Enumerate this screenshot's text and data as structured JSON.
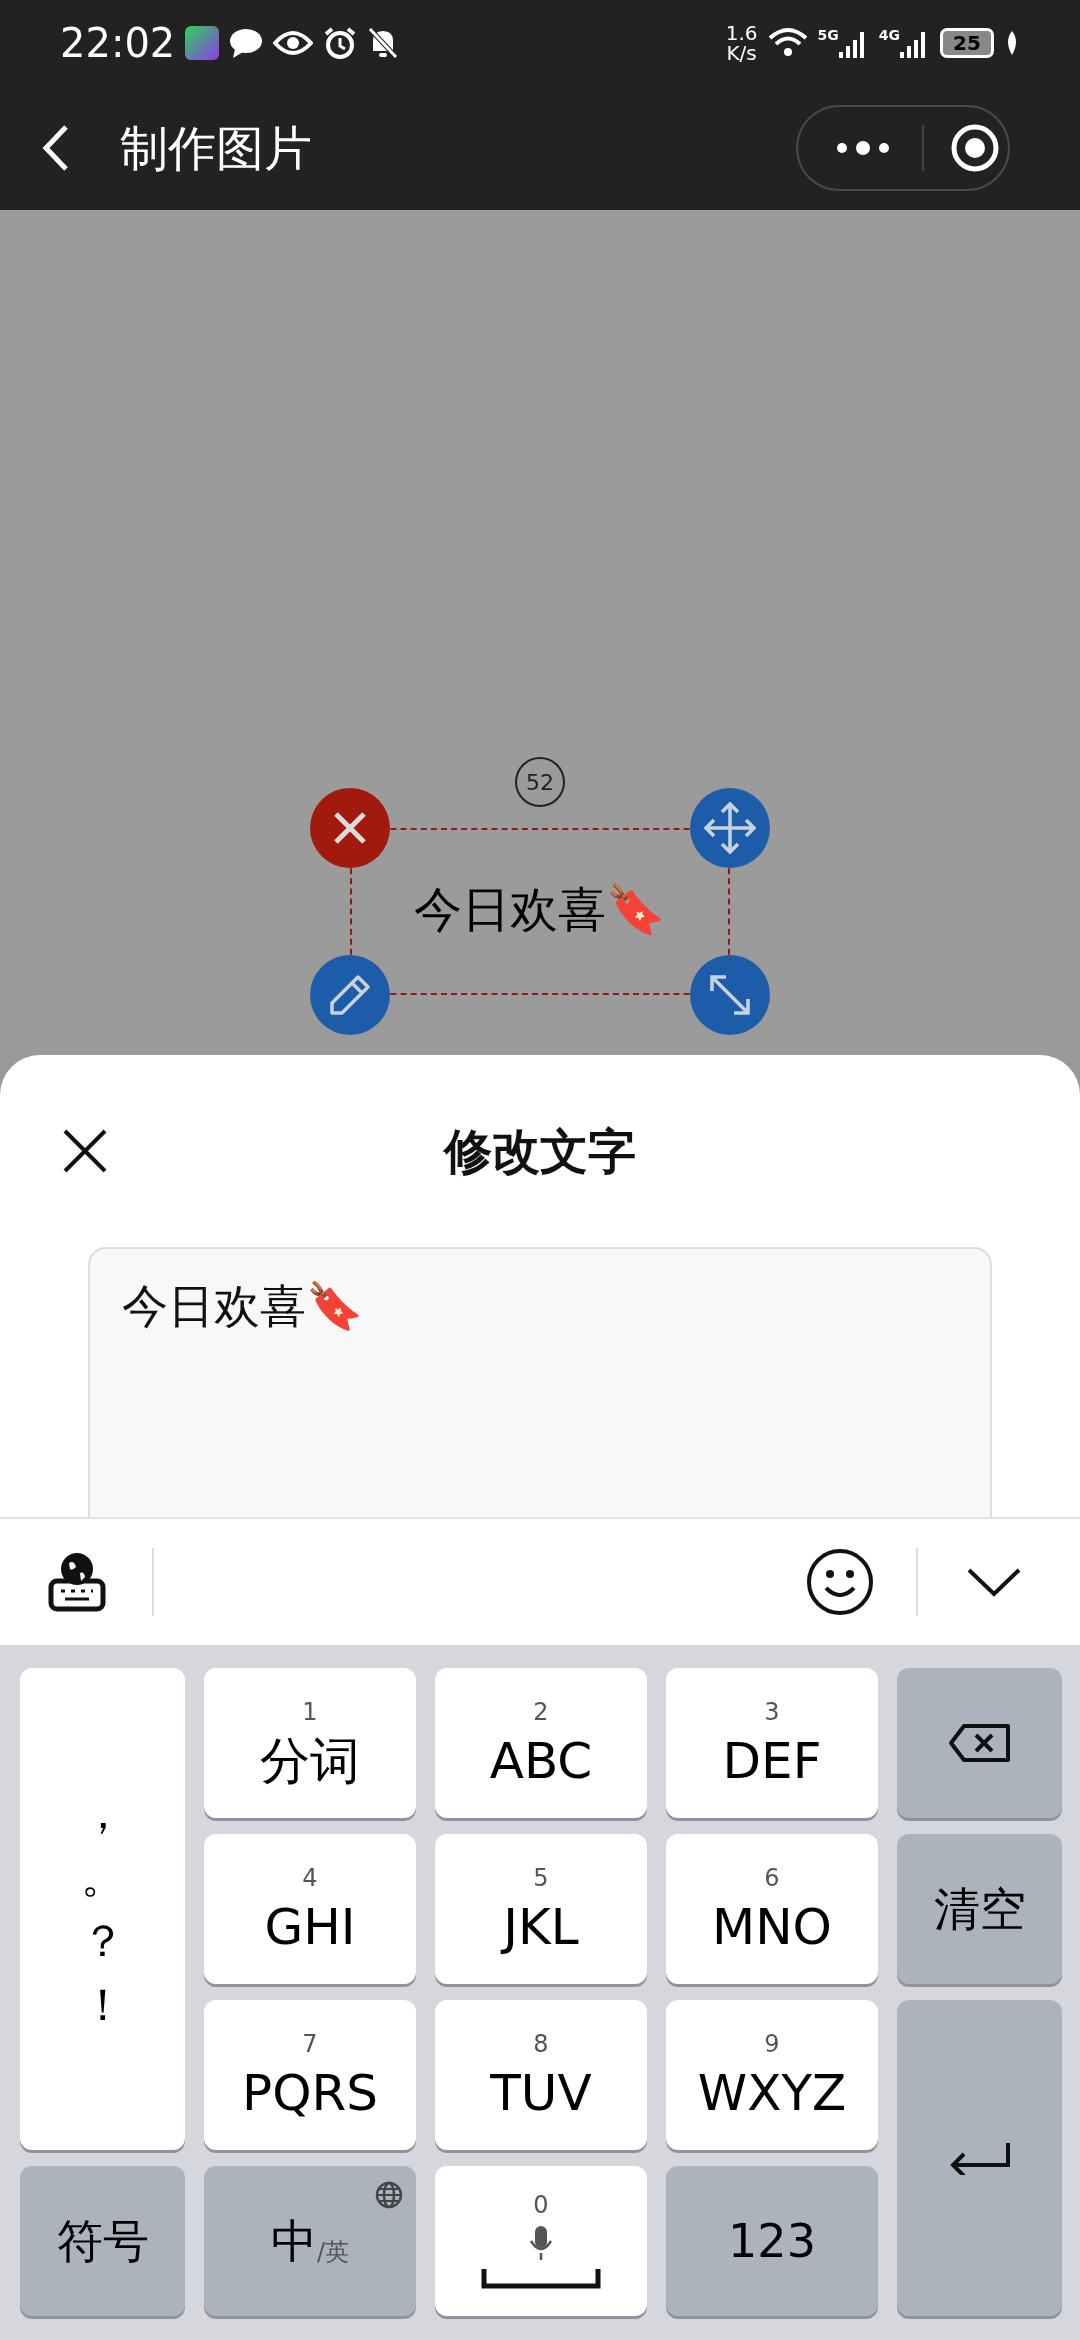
{
  "status_bar": {
    "time": "22:02",
    "net_speed": "1.6",
    "net_unit": "K/s",
    "signals": [
      "5G",
      "4G"
    ],
    "battery": "25"
  },
  "nav_bar": {
    "title": "制作图片"
  },
  "canvas": {
    "layer_number": "52",
    "text": "今日欢喜🔖"
  },
  "edit_sheet": {
    "title": "修改文字",
    "text_value": "今日欢喜🔖"
  },
  "keyboard": {
    "keys": [
      {
        "kind": "punct",
        "chars": [
          "，",
          "。",
          "？",
          "！"
        ]
      },
      {
        "kind": "letter",
        "number": "1",
        "label": "分词"
      },
      {
        "kind": "letter",
        "number": "2",
        "label": "ABC"
      },
      {
        "kind": "letter",
        "number": "3",
        "label": "DEF"
      },
      {
        "kind": "backspace"
      },
      {
        "kind": "letter",
        "number": "4",
        "label": "GHI"
      },
      {
        "kind": "letter",
        "number": "5",
        "label": "JKL"
      },
      {
        "kind": "letter",
        "number": "6",
        "label": "MNO"
      },
      {
        "kind": "function",
        "label": "清空"
      },
      {
        "kind": "letter",
        "number": "7",
        "label": "PQRS"
      },
      {
        "kind": "letter",
        "number": "8",
        "label": "TUV"
      },
      {
        "kind": "letter",
        "number": "9",
        "label": "WXYZ"
      },
      {
        "kind": "enter"
      },
      {
        "kind": "function",
        "label": "符号"
      },
      {
        "kind": "lang",
        "label": "中",
        "sub": "/英"
      },
      {
        "kind": "space",
        "number": "0"
      },
      {
        "kind": "function",
        "label": "123"
      }
    ]
  }
}
